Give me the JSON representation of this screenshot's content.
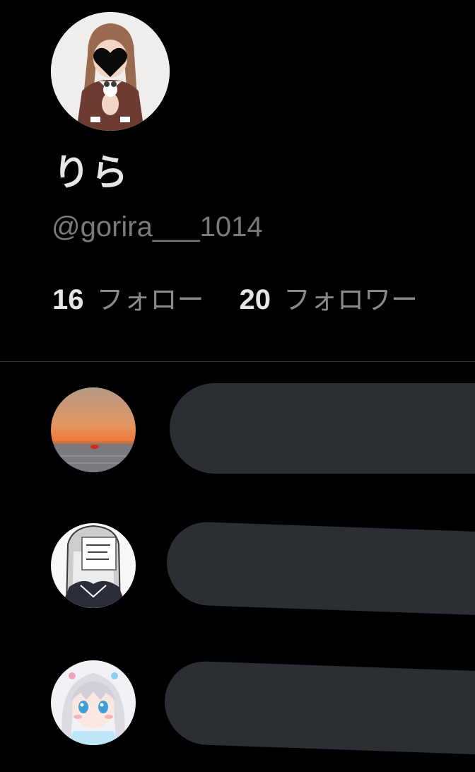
{
  "profile": {
    "display_name": "りら",
    "handle": "@gorira___1014",
    "avatar_icon": "profile-photo",
    "following": {
      "count": "16",
      "label": "フォロー"
    },
    "followers": {
      "count": "20",
      "label": "フォロワー"
    }
  },
  "list": [
    {
      "avatar_icon": "sunset-photo"
    },
    {
      "avatar_icon": "anime-sketch"
    },
    {
      "avatar_icon": "anime-girl"
    }
  ],
  "colors": {
    "background": "#000000",
    "text_primary": "#e6e6e6",
    "text_secondary": "#7a7a7a",
    "divider": "#2f3336",
    "placeholder": "#2b2e32"
  }
}
